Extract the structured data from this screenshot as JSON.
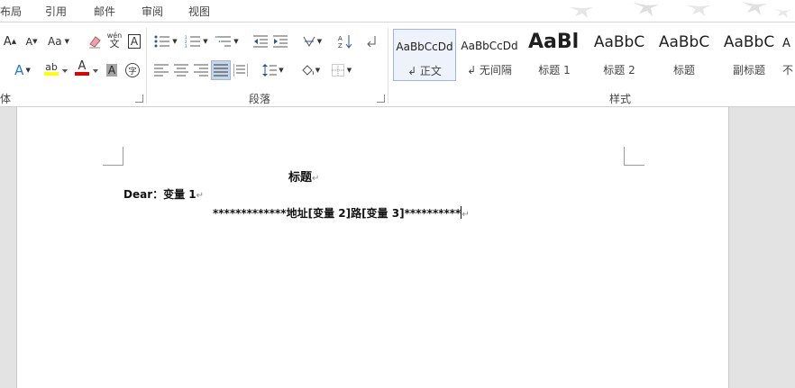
{
  "tabs": [
    "布局",
    "引用",
    "邮件",
    "审阅",
    "视图"
  ],
  "groups": {
    "font_partial": "体",
    "paragraph": "段落",
    "styles": "样式"
  },
  "font_icons": {
    "grow": "A",
    "shrink": "A",
    "change_case": "Aa",
    "phonetic_top": "wén",
    "phonetic_bottom": "文",
    "border_char": "A",
    "text_effects": "A",
    "highlight": "ab",
    "font_color": "A",
    "char_shading": "A",
    "enclose": "字"
  },
  "colors": {
    "accent": "#2b579a",
    "highlight_bar": "#ffff00",
    "font_color_bar": "#e00000",
    "selected": "#c5d5ea"
  },
  "styles": [
    {
      "sample": "AaBbCcDd",
      "name": "↲ 正文",
      "active": true
    },
    {
      "sample": "AaBbCcDd",
      "name": "↲ 无间隔",
      "active": false
    },
    {
      "sample": "AaBl",
      "name": "标题 1",
      "active": false
    },
    {
      "sample": "AaBbC",
      "name": "标题 2",
      "active": false
    },
    {
      "sample": "AaBbC",
      "name": "标题",
      "active": false
    },
    {
      "sample": "AaBbC",
      "name": "副标题",
      "active": false
    },
    {
      "sample": "A",
      "name": "不",
      "active": false
    }
  ],
  "document": {
    "title": "标题",
    "greeting": "Dear：变量 1",
    "address_line": "*************地址[变量 2]路[变量 3]**********",
    "para_mark": "↵"
  }
}
